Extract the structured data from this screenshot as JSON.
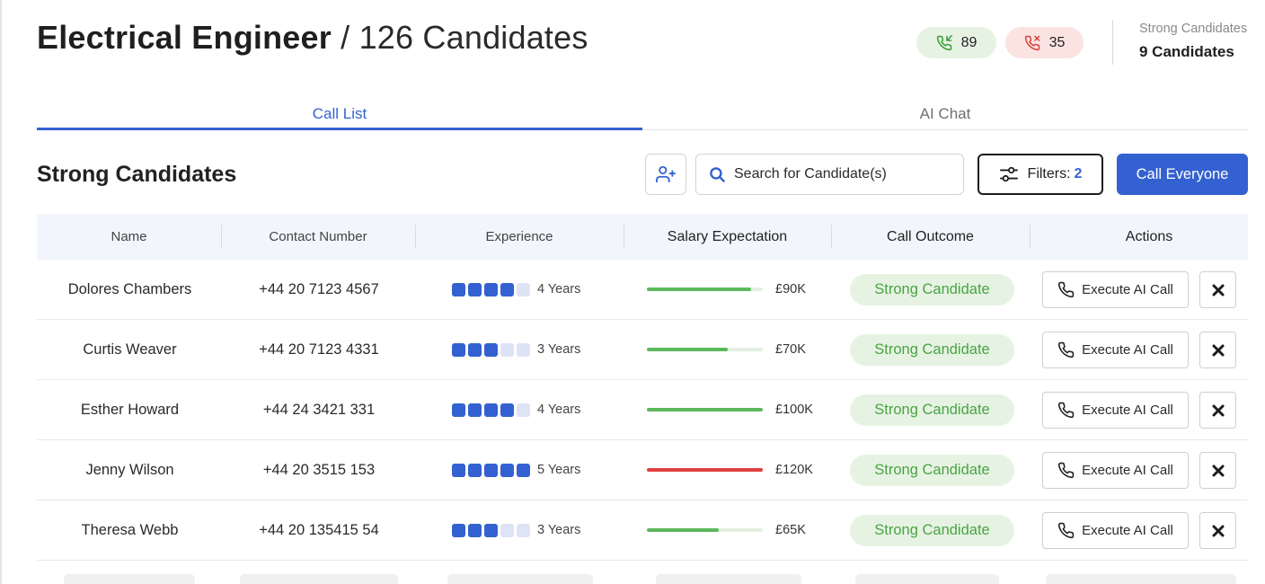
{
  "header": {
    "title_role": "Electrical Engineer",
    "title_separator": "/",
    "title_count": "126 Candidates",
    "answered_calls": "89",
    "missed_calls": "35",
    "strong_label": "Strong Candidates",
    "strong_value": "9 Candidates"
  },
  "tabs": [
    {
      "label": "Call List",
      "active": true
    },
    {
      "label": "AI Chat",
      "active": false
    }
  ],
  "toolbar": {
    "section_title": "Strong Candidates",
    "add_candidate_icon": "user-plus-icon",
    "search_placeholder": "Search for Candidate(s)",
    "filters_label": "Filters:",
    "filters_count": "2",
    "call_everyone_label": "Call Everyone"
  },
  "table": {
    "columns": [
      "Name",
      "Contact Number",
      "Experience",
      "Salary Expectation",
      "Call Outcome",
      "Actions"
    ],
    "rows": [
      {
        "name": "Dolores Chambers",
        "phone": "+44 20 7123 4567",
        "exp_level": 4,
        "experience": "4 Years",
        "salary_level": 0.9,
        "salary_status": "ok",
        "salary": "£90K",
        "outcome": "Strong Candidate",
        "action": "Execute AI Call"
      },
      {
        "name": "Curtis Weaver",
        "phone": "+44 20 7123 4331",
        "exp_level": 3,
        "experience": "3 Years",
        "salary_level": 0.7,
        "salary_status": "ok",
        "salary": "£70K",
        "outcome": "Strong Candidate",
        "action": "Execute AI Call"
      },
      {
        "name": "Esther Howard",
        "phone": "+44 24 3421 331",
        "exp_level": 4,
        "experience": "4 Years",
        "salary_level": 1.0,
        "salary_status": "ok",
        "salary": "£100K",
        "outcome": "Strong Candidate",
        "action": "Execute AI Call"
      },
      {
        "name": "Jenny Wilson",
        "phone": "+44 20 3515 153",
        "exp_level": 5,
        "experience": "5 Years",
        "salary_level": 1.0,
        "salary_status": "over",
        "salary": "£120K",
        "outcome": "Strong Candidate",
        "action": "Execute AI Call"
      },
      {
        "name": "Theresa Webb",
        "phone": "+44 20 135415 54",
        "exp_level": 3,
        "experience": "3 Years",
        "salary_level": 0.62,
        "salary_status": "ok",
        "salary": "£65K",
        "outcome": "Strong Candidate",
        "action": "Execute AI Call"
      }
    ]
  },
  "colors": {
    "accent": "#3461d1",
    "success": "#4aa345",
    "danger": "#e04040"
  }
}
